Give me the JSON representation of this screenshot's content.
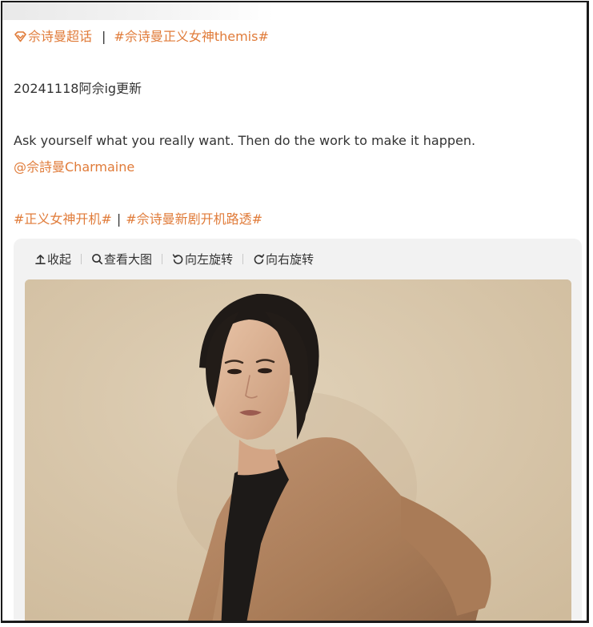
{
  "post": {
    "topic_super": "佘诗曼超话",
    "separator": "|",
    "topic_tag": "#佘诗曼正义女神themis#",
    "date_line": "20241118阿佘ig更新",
    "quote": "Ask yourself what you really want. Then do the work to make it happen.",
    "mention": "@佘詩曼Charmaine",
    "hashtag_1": "#正义女神开机#",
    "hashtag_sep": "|",
    "hashtag_2": "#佘诗曼新剧开机路透#"
  },
  "viewer": {
    "toolbar": {
      "collapse_label": "收起",
      "view_large_label": "查看大图",
      "rotate_left_label": "向左旋转",
      "rotate_right_label": "向右旋转"
    }
  },
  "colors": {
    "accent": "#e07b39",
    "text": "#333333",
    "viewer_bg": "#f2f2f2",
    "photo_bg": "#d9c8ae",
    "coat": "#b38661"
  }
}
